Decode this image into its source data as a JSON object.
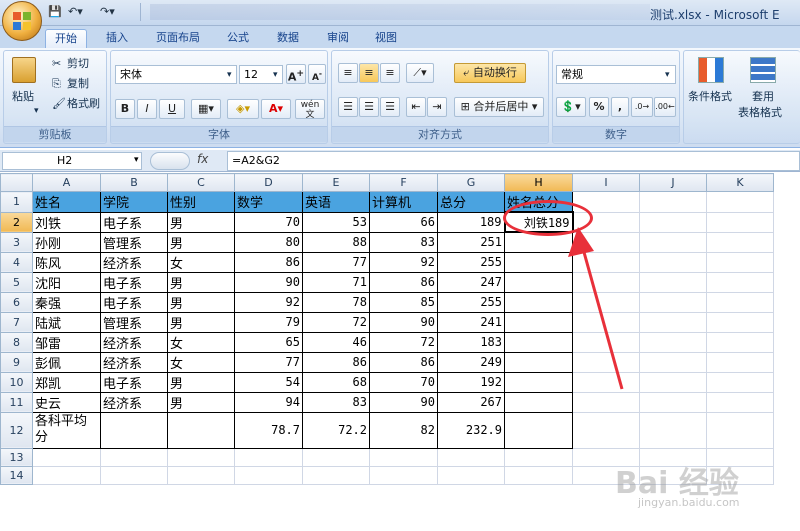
{
  "window": {
    "title": "测试.xlsx - Microsoft E"
  },
  "tabs": [
    "开始",
    "插入",
    "页面布局",
    "公式",
    "数据",
    "审阅",
    "视图"
  ],
  "clipboard": {
    "paste": "粘贴",
    "cut": "剪切",
    "copy": "复制",
    "format_painter": "格式刷",
    "label": "剪贴板"
  },
  "font": {
    "name": "宋体",
    "size": "12",
    "label": "字体",
    "bold": "B",
    "italic": "I",
    "underline": "U",
    "wen": "wén"
  },
  "alignment": {
    "wrap": "自动换行",
    "merge": "合并后居中",
    "label": "对齐方式"
  },
  "number": {
    "format": "常规",
    "percent": "%",
    "comma": ",",
    "label": "数字"
  },
  "styles": {
    "conditional": "条件格式",
    "table_format_1": "套用",
    "table_format_2": "表格格式"
  },
  "namebox": "H2",
  "formula": "=A2&G2",
  "fx": "fx",
  "colors": {
    "header_fill": "#4aa3e0",
    "selected_header": "#f1b954",
    "annotation": "#e8303a"
  },
  "columns": [
    "",
    "A",
    "B",
    "C",
    "D",
    "E",
    "F",
    "G",
    "H",
    "I",
    "J",
    "K"
  ],
  "rows": [
    [
      "姓名",
      "学院",
      "性别",
      "数学",
      "英语",
      "计算机",
      "总分",
      "姓名总分"
    ],
    [
      "刘铁",
      "电子系",
      "男",
      "70",
      "53",
      "66",
      "189",
      "刘铁189"
    ],
    [
      "孙刚",
      "管理系",
      "男",
      "80",
      "88",
      "83",
      "251",
      ""
    ],
    [
      "陈风",
      "经济系",
      "女",
      "86",
      "77",
      "92",
      "255",
      ""
    ],
    [
      "沈阳",
      "电子系",
      "男",
      "90",
      "71",
      "86",
      "247",
      ""
    ],
    [
      "秦强",
      "电子系",
      "男",
      "92",
      "78",
      "85",
      "255",
      ""
    ],
    [
      "陆斌",
      "管理系",
      "男",
      "79",
      "72",
      "90",
      "241",
      ""
    ],
    [
      "邹雷",
      "经济系",
      "女",
      "65",
      "46",
      "72",
      "183",
      ""
    ],
    [
      "彭佩",
      "经济系",
      "女",
      "77",
      "86",
      "86",
      "249",
      ""
    ],
    [
      "郑凯",
      "电子系",
      "男",
      "54",
      "68",
      "70",
      "192",
      ""
    ],
    [
      "史云",
      "经济系",
      "男",
      "94",
      "83",
      "90",
      "267",
      ""
    ],
    [
      "各科平均分",
      "",
      "",
      "78.7",
      "72.2",
      "82",
      "232.9",
      ""
    ]
  ],
  "watermark": "Bai 经验",
  "watermark_url": "jingyan.baidu.com"
}
